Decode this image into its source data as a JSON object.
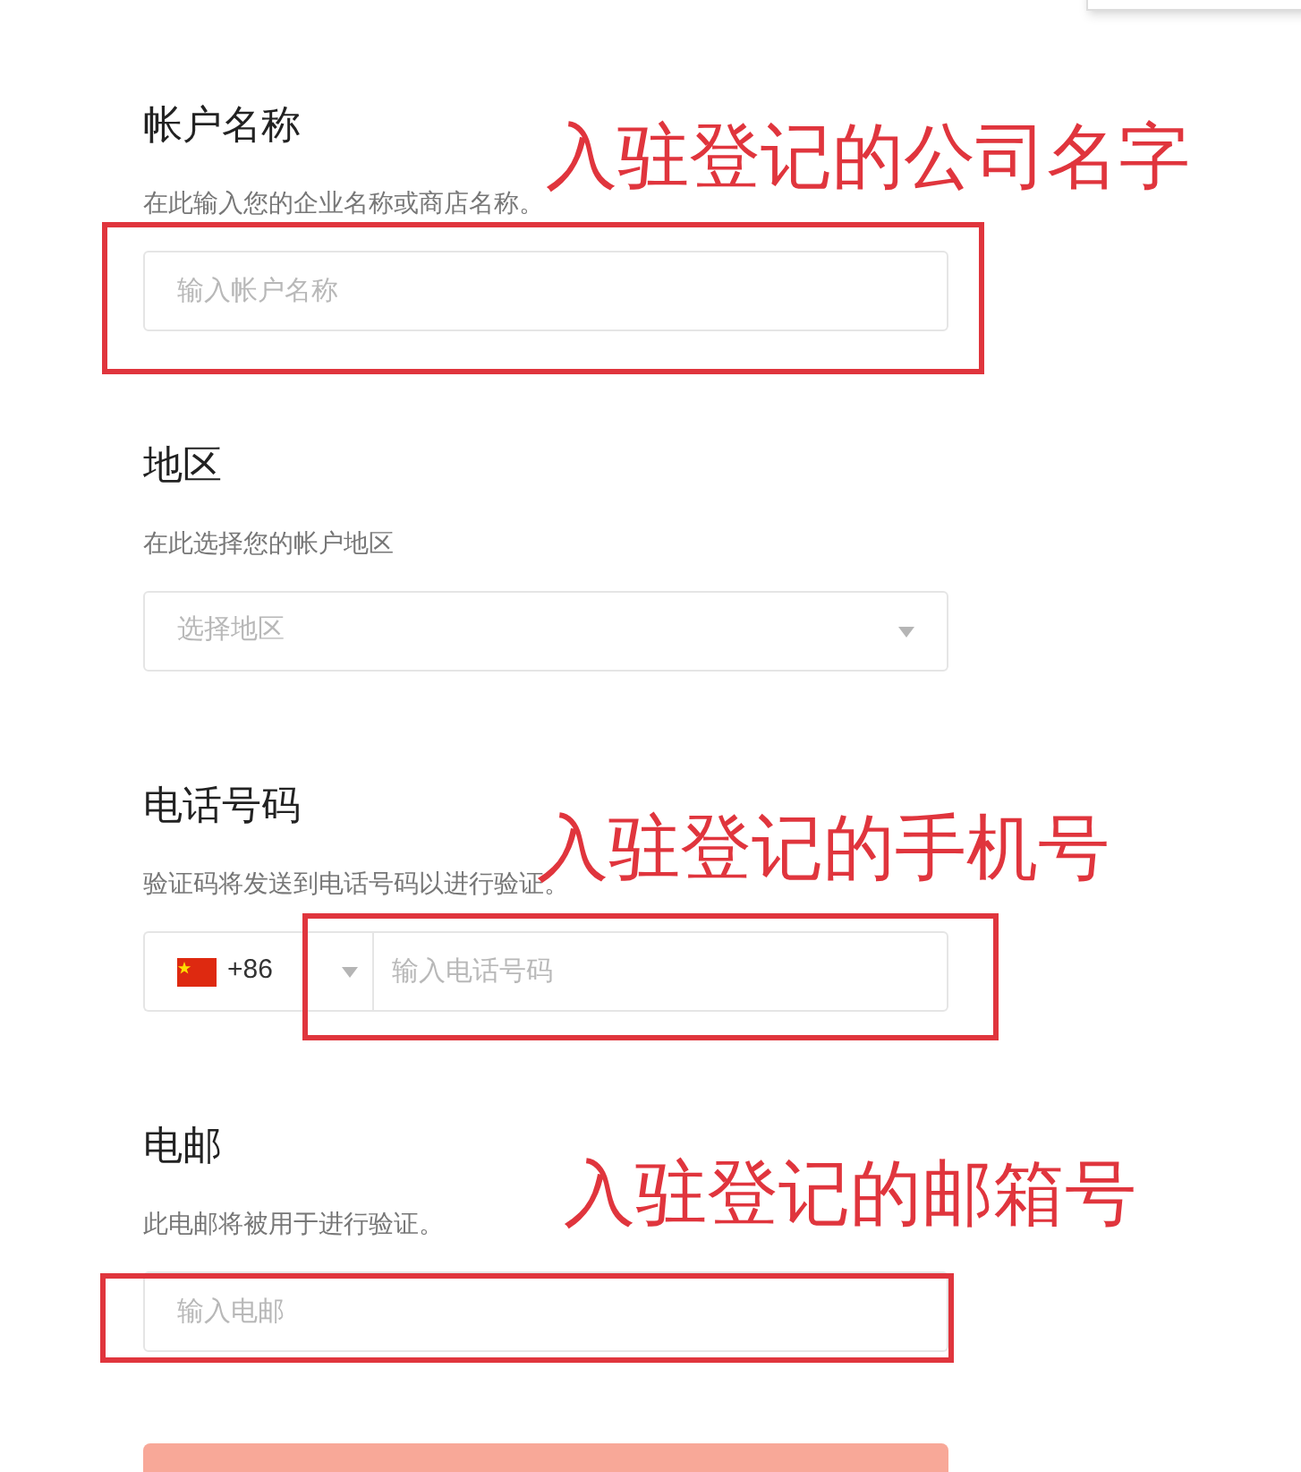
{
  "sections": [
    {
      "title": "帐户名称",
      "description": "在此输入您的企业名称或商店名称。",
      "field": {
        "kind": "text",
        "placeholder": "输入帐户名称"
      },
      "annotation": "入驻登记的公司名字"
    },
    {
      "title": "地区",
      "description": "在此选择您的帐户地区",
      "field": {
        "kind": "select",
        "placeholder": "选择地区"
      }
    },
    {
      "title": "电话号码",
      "description": "验证码将发送到电话号码以进行验证。",
      "field": {
        "kind": "phone",
        "code": "+86",
        "placeholder": "输入电话号码"
      },
      "annotation": "入驻登记的手机号"
    },
    {
      "title": "电邮",
      "description": "此电邮将被用于进行验证。",
      "field": {
        "kind": "email",
        "placeholder": "输入电邮"
      },
      "annotation": "入驻登记的邮箱号"
    }
  ]
}
